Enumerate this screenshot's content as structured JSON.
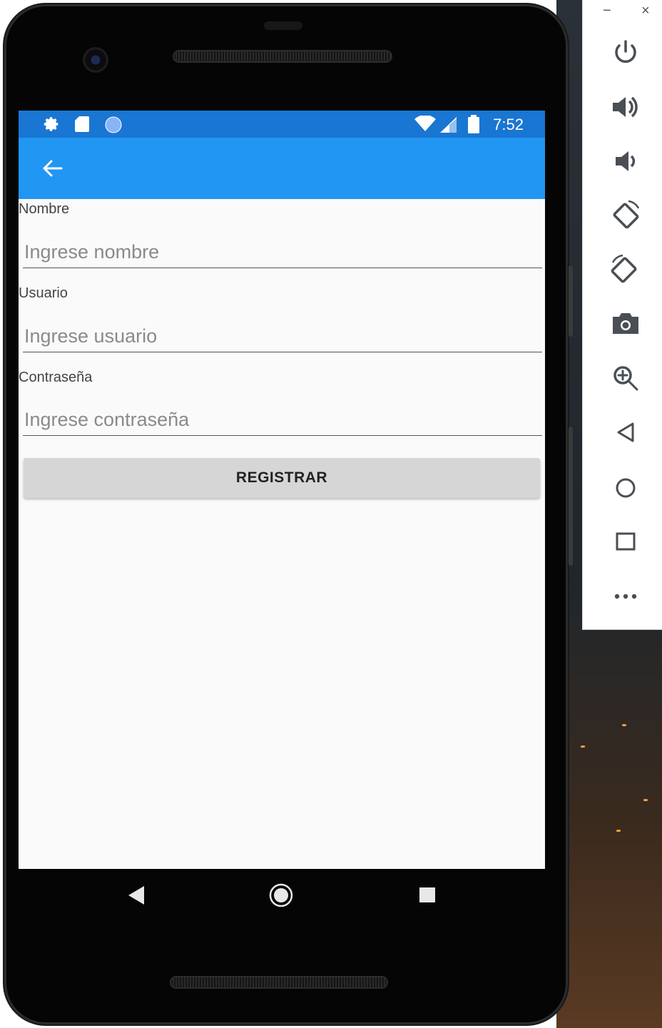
{
  "status_bar": {
    "time": "7:52",
    "left_icons": [
      "gear-icon",
      "sd-card-icon",
      "circle-icon"
    ],
    "right_icons": [
      "wifi-icon",
      "signal-icon",
      "battery-icon"
    ]
  },
  "app_bar": {
    "back_icon": "arrow-left-icon"
  },
  "form": {
    "nombre": {
      "label": "Nombre",
      "placeholder": "Ingrese nombre",
      "value": ""
    },
    "usuario": {
      "label": "Usuario",
      "placeholder": "Ingrese usuario",
      "value": ""
    },
    "contrasena": {
      "label": "Contraseña",
      "placeholder": "Ingrese contraseña",
      "value": ""
    },
    "register_label": "REGISTRAR"
  },
  "nav_bar": {
    "buttons": [
      "back-triangle-icon",
      "home-circle-icon",
      "recents-square-icon"
    ]
  },
  "emulator_toolbar": {
    "window_controls": {
      "minimize": "−",
      "close": "×"
    },
    "buttons": [
      "power-icon",
      "volume-up-icon",
      "volume-down-icon",
      "rotate-left-icon",
      "rotate-right-icon",
      "camera-icon",
      "zoom-icon",
      "back-icon",
      "home-icon",
      "overview-icon",
      "more-icon"
    ]
  },
  "colors": {
    "status_bar": "#1976d2",
    "app_bar": "#2196f3",
    "screen_bg": "#fafafa",
    "button_bg": "#d6d6d6"
  }
}
